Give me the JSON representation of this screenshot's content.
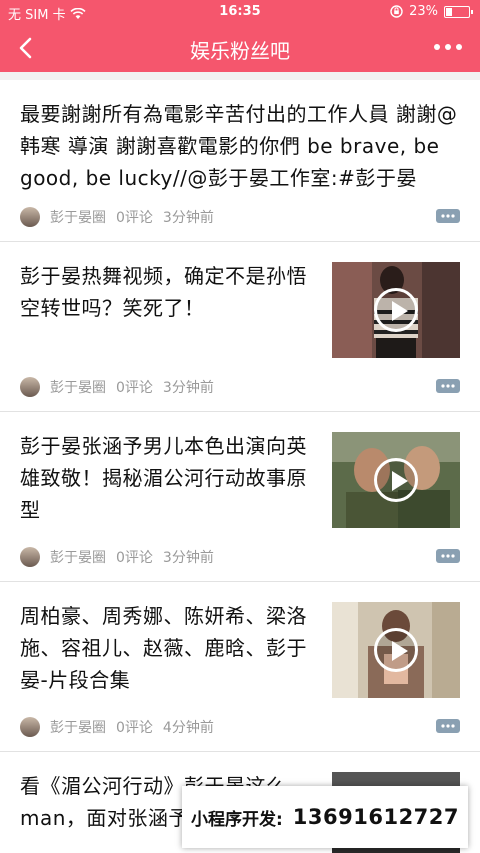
{
  "status_bar": {
    "carrier": "无 SIM 卡",
    "time": "16:35",
    "battery": "23%",
    "battery_level": 0.23
  },
  "header": {
    "title": "娱乐粉丝吧"
  },
  "articles": [
    {
      "title": "最要謝謝所有為電影辛苦付出的工作人員 謝謝@韩寒 導演 謝謝喜歡電影的你們 be brave, be good, be lucky//@彭于晏工作室:#彭于晏##...",
      "author": "彭于晏圈",
      "comments": "0评论",
      "time": "3分钟前"
    },
    {
      "title": "彭于晏热舞视频，确定不是孙悟空转世吗？笑死了！",
      "author": "彭于晏圈",
      "comments": "0评论",
      "time": "3分钟前"
    },
    {
      "title": "彭于晏张涵予男儿本色出演向英雄致敬！揭秘湄公河行动故事原型",
      "author": "彭于晏圈",
      "comments": "0评论",
      "time": "3分钟前"
    },
    {
      "title": "周柏豪、周秀娜、陈妍希、梁洛施、容祖儿、赵薇、鹿晗、彭于晏-片段合集",
      "author": "彭于晏圈",
      "comments": "0评论",
      "time": "4分钟前"
    },
    {
      "title": "看《湄公河行动》彭于晏这么man，面对张涵予"
    }
  ],
  "banner": {
    "label": "小程序开发:",
    "phone": "13691612727"
  },
  "colors": {
    "accent": "#f5566d"
  }
}
